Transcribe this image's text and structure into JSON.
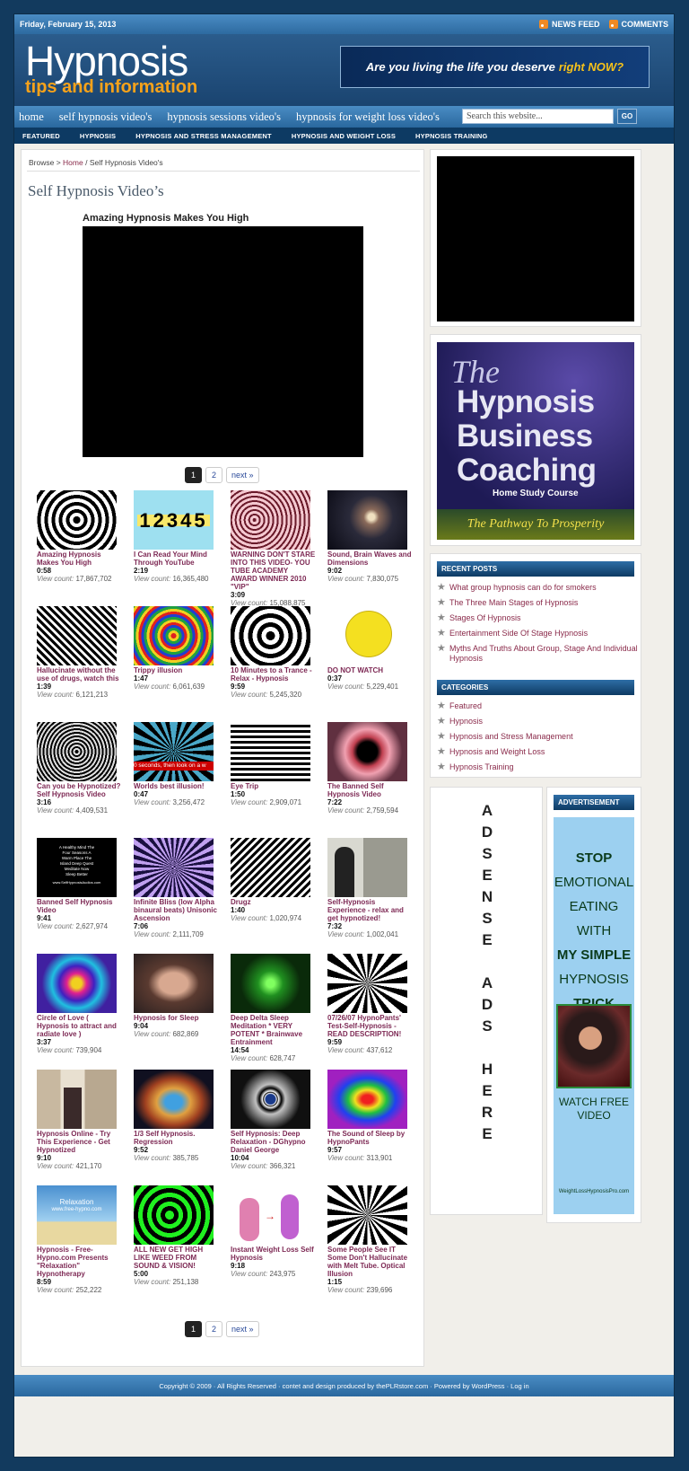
{
  "topbar": {
    "date": "Friday, February 15, 2013",
    "news_feed": "NEWS FEED",
    "comments": "COMMENTS"
  },
  "header": {
    "logo_main": "Hypnosis",
    "logo_sub": "tips and information",
    "banner_text": "Are you living the life you deserve",
    "banner_accent": "right NOW?"
  },
  "nav": {
    "items": [
      "home",
      "self hypnosis video's",
      "hypnosis sessions video's",
      "hypnosis for weight loss video's"
    ],
    "search_placeholder": "Search this website...",
    "go": "GO"
  },
  "catnav": {
    "items": [
      "FEATURED",
      "HYPNOSIS",
      "HYPNOSIS AND STRESS MANAGEMENT",
      "HYPNOSIS AND WEIGHT LOSS",
      "HYPNOSIS TRAINING"
    ]
  },
  "breadcrumb": {
    "browse": "Browse >",
    "home": "Home",
    "sep": "/",
    "current": "Self Hypnosis Video's"
  },
  "page": {
    "title": "Self Hypnosis Video’s",
    "video_title": "Amazing Hypnosis Makes You High"
  },
  "pager": {
    "p1": "1",
    "p2": "2",
    "next": "next »"
  },
  "view_label": "View count:",
  "videos": [
    {
      "title": "Amazing Hypnosis Makes You High",
      "dur": "0:58",
      "views": "17,867,702"
    },
    {
      "title": "I Can Read Your Mind Through YouTube",
      "dur": "2:19",
      "views": "16,365,480"
    },
    {
      "title": "WARNING DON'T STARE INTO THIS VIDEO- YOU TUBE ACADEMY AWARD WINNER 2010 \"VIP\"",
      "dur": "3:09",
      "views": "15,088,875"
    },
    {
      "title": "Sound, Brain Waves and Dimensions",
      "dur": "9:02",
      "views": "7,830,075"
    },
    {
      "title": "Hallucinate without the use of drugs, watch this",
      "dur": "1:39",
      "views": "6,121,213"
    },
    {
      "title": "Trippy illusion",
      "dur": "1:47",
      "views": "6,061,639"
    },
    {
      "title": "10 Minutes to a Trance - Relax - Hypnosis",
      "dur": "9:59",
      "views": "5,245,320"
    },
    {
      "title": "DO NOT WATCH",
      "dur": "0:37",
      "views": "5,229,401"
    },
    {
      "title": "Can you be Hypnotized? Self Hypnosis Video",
      "dur": "3:16",
      "views": "4,409,531"
    },
    {
      "title": "Worlds best illusion!",
      "dur": "0:47",
      "views": "3,256,472"
    },
    {
      "title": "Eye Trip",
      "dur": "1:50",
      "views": "2,909,071"
    },
    {
      "title": "The Banned Self Hypnosis Video",
      "dur": "7:22",
      "views": "2,759,594"
    },
    {
      "title": "Banned Self Hypnosis Video",
      "dur": "9:41",
      "views": "2,627,974"
    },
    {
      "title": "Infinite Bliss (low Alpha binaural beats) Unisonic Ascension",
      "dur": "7:06",
      "views": "2,111,709"
    },
    {
      "title": "Drugz",
      "dur": "1:40",
      "views": "1,020,974"
    },
    {
      "title": "Self-Hypnosis Experience - relax and get hypnotized!",
      "dur": "7:32",
      "views": "1,002,041"
    },
    {
      "title": "Circle of Love ( Hypnosis to attract and radiate love )",
      "dur": "3:37",
      "views": "739,904"
    },
    {
      "title": "Hypnosis for Sleep",
      "dur": "9:04",
      "views": "682,869"
    },
    {
      "title": "Deep Delta Sleep Meditation * VERY POTENT * Brainwave Entrainment",
      "dur": "14:54",
      "views": "628,747"
    },
    {
      "title": "07/26/07 HypnoPants' Test-Self-Hypnosis - READ DESCRIPTION!",
      "dur": "9:59",
      "views": "437,612"
    },
    {
      "title": "Hypnosis Online - Try This Experience - Get Hypnotized",
      "dur": "9:10",
      "views": "421,170"
    },
    {
      "title": "1/3 Self Hypnosis. Regression",
      "dur": "9:52",
      "views": "385,785"
    },
    {
      "title": "Self Hypnosis: Deep Relaxation - DGhypno Daniel George",
      "dur": "10:04",
      "views": "366,321"
    },
    {
      "title": "The Sound of Sleep by HypnoPants",
      "dur": "9:57",
      "views": "313,901"
    },
    {
      "title": "Hypnosis - Free-Hypno.com Presents \"Relaxation\" Hypnotherapy",
      "dur": "8:59",
      "views": "252,222"
    },
    {
      "title": "ALL NEW GET HIGH LIKE WEED FROM SOUND & VISION!",
      "dur": "5:00",
      "views": "251,138"
    },
    {
      "title": "Instant Weight Loss Self Hypnosis",
      "dur": "9:18",
      "views": "243,975"
    },
    {
      "title": "Some People See IT Some Don't Hallucinate with Melt Tube. Optical Illusion",
      "dur": "1:15",
      "views": "239,696"
    }
  ],
  "thumb_text": {
    "numbers": "12345",
    "relax": "Relaxation",
    "relax_url": "www.free-hypno.com",
    "worlds": "0 seconds, then look on a w",
    "banned": "A Healthy Mind The Four Seasons A Warm Place The Island Deep Quest Meditate Now Sleep Better",
    "banned_url": "www.SelfHypnosisAudios.com"
  },
  "sidebar": {
    "ad_the": "The",
    "ad_title": "Hypnosis Business Coaching",
    "ad_sub": "Home Study Course",
    "ad_tag": "The Pathway To Prosperity",
    "recent_header": "RECENT POSTS",
    "recent": [
      "What group hypnosis can do for smokers",
      "The Three Main Stages of Hypnosis",
      "Stages Of Hypnosis",
      "Entertainment Side Of Stage Hypnosis",
      "Myths And Truths About Group, Stage And Individual Hypnosis"
    ],
    "cat_header": "CATEGORIES",
    "categories": [
      "Featured",
      "Hypnosis",
      "Hypnosis and Stress Management",
      "Hypnosis and Weight Loss",
      "Hypnosis Training"
    ],
    "adsense_letters": [
      "A",
      "D",
      "S",
      "E",
      "N",
      "S",
      "E",
      "",
      "A",
      "D",
      "S",
      "",
      "H",
      "E",
      "R",
      "E"
    ],
    "adv_header": "ADVERTISEMENT",
    "adv_lines": [
      "STOP",
      "EMOTIONAL",
      "EATING WITH",
      "MY SIMPLE",
      "HYPNOSIS",
      "TRICK"
    ],
    "adv_watch": "WATCH FREE VIDEO",
    "adv_url": "WeightLossHypnosisPro.com"
  },
  "footer": {
    "text": "Copyright © 2009 · All Rights Reserved · contet and design produced by thePLRstore.com · Powered by WordPress · Log in"
  }
}
